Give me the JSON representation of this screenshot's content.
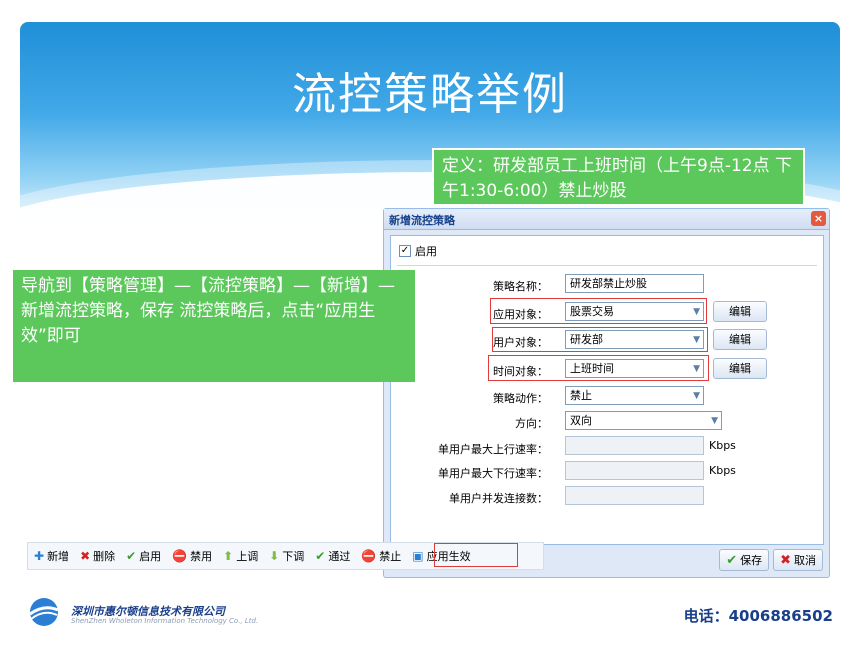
{
  "slide": {
    "title": "流控策略举例",
    "definition_callout": "定义：研发部员工上班时间（上午9点-12点 下午1:30-6:00）禁止炒股",
    "navigation_callout": "导航到【策略管理】—【流控策略】—【新增】—新增流控策略，保存 流控策略后，点击“应用生效”即可"
  },
  "dialog": {
    "title": "新增流控策略",
    "close_glyph": "×",
    "enable_label": "启用",
    "enable_checked": "✓",
    "fields": {
      "policy_name": {
        "label": "策略名称：",
        "value": "研发部禁止炒股"
      },
      "app_object": {
        "label": "应用对象：",
        "value": "股票交易",
        "button": "编辑"
      },
      "user_object": {
        "label": "用户对象：",
        "value": "研发部",
        "button": "编辑"
      },
      "time_object": {
        "label": "时间对象：",
        "value": "上班时间",
        "button": "编辑"
      },
      "policy_action": {
        "label": "策略动作：",
        "value": "禁止"
      },
      "direction": {
        "label": "方向：",
        "value": "双向"
      },
      "max_up_rate": {
        "label": "单用户最大上行速率：",
        "value": "",
        "unit": "Kbps"
      },
      "max_down_rate": {
        "label": "单用户最大下行速率：",
        "value": "",
        "unit": "Kbps"
      },
      "max_connections": {
        "label": "单用户并发连接数：",
        "value": ""
      }
    },
    "save_label": "保存",
    "cancel_label": "取消"
  },
  "toolbar": {
    "items": [
      {
        "label": "新增",
        "icon": "plus-icon"
      },
      {
        "label": "删除",
        "icon": "delete-x-icon"
      },
      {
        "label": "启用",
        "icon": "check-icon"
      },
      {
        "label": "禁用",
        "icon": "ban-icon"
      },
      {
        "label": "上调",
        "icon": "arrow-up-icon"
      },
      {
        "label": "下调",
        "icon": "arrow-down-icon"
      },
      {
        "label": "通过",
        "icon": "check-icon"
      },
      {
        "label": "禁止",
        "icon": "ban-icon"
      },
      {
        "label": "应用生效",
        "icon": "apply-icon"
      }
    ]
  },
  "footer": {
    "company_cn": "深圳市惠尔顿信息技术有限公司",
    "company_en": "ShenZhen Wholeton Information Technology Co., Ltd.",
    "phone": "电话：4006886502"
  },
  "colors": {
    "banner_blue": "#1f8fd8",
    "callout_green": "#5cc85c",
    "highlight_red": "#e03c3c",
    "brand_navy": "#1a3f8a"
  }
}
